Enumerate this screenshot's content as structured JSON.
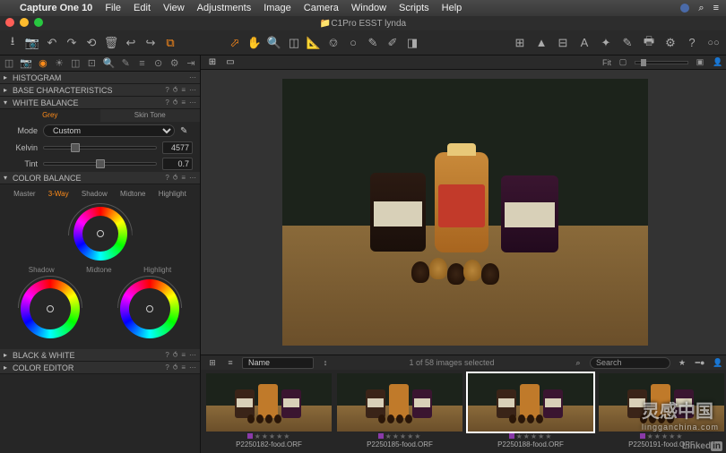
{
  "menubar": {
    "app": "Capture One 10",
    "items": [
      "File",
      "Edit",
      "View",
      "Adjustments",
      "Image",
      "Camera",
      "Window",
      "Scripts",
      "Help"
    ]
  },
  "window": {
    "title": "C1Pro ESST lynda"
  },
  "sidebar": {
    "panels": {
      "histogram": "HISTOGRAM",
      "base": "BASE CHARACTERISTICS",
      "wb": "WHITE BALANCE",
      "cb": "COLOR BALANCE",
      "bw": "BLACK & WHITE",
      "ce": "COLOR EDITOR"
    },
    "wb": {
      "tab_grey": "Grey",
      "tab_skin": "Skin Tone",
      "mode_label": "Mode",
      "mode_value": "Custom",
      "kelvin_label": "Kelvin",
      "kelvin_value": "4577",
      "tint_label": "Tint",
      "tint_value": "0.7"
    },
    "cb": {
      "tabs": [
        "Master",
        "3-Way",
        "Shadow",
        "Midtone",
        "Highlight"
      ],
      "active_tab": "3-Way",
      "label_shadow": "Shadow",
      "label_mid": "Midtone",
      "label_hi": "Highlight"
    }
  },
  "viewer": {
    "fit_label": "Fit"
  },
  "browser": {
    "sort_label": "Name",
    "selection": "1 of 58 images selected",
    "search_placeholder": "Search",
    "thumbs": [
      {
        "name": "P2250182-food.ORF"
      },
      {
        "name": "P2250185-food.ORF"
      },
      {
        "name": "P2250188-food.ORF"
      },
      {
        "name": "P2250191-food.ORF"
      }
    ]
  },
  "watermark": {
    "line1": "灵感中国",
    "line2": "lingganchina.com"
  },
  "footer": {
    "linkedin": "Linked",
    "in": "in"
  }
}
